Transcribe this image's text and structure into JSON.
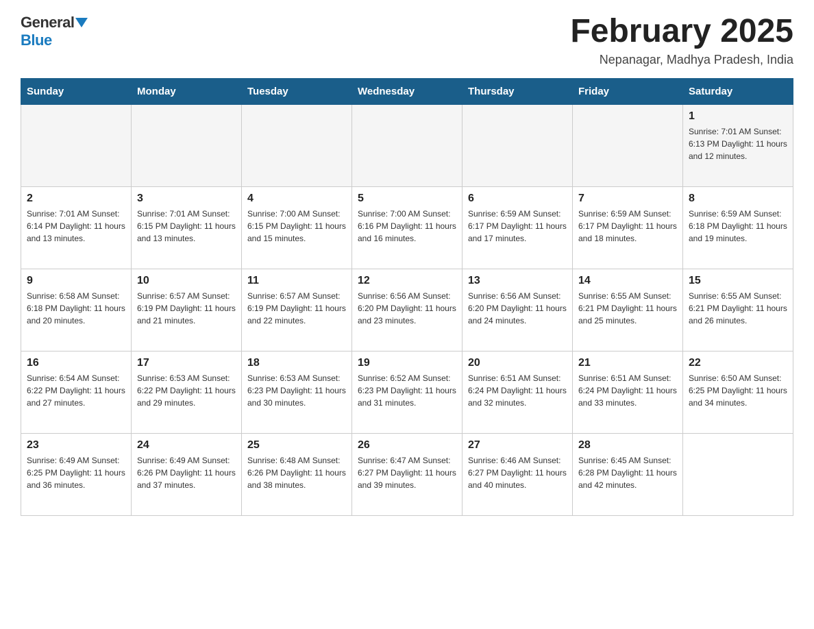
{
  "header": {
    "logo": {
      "general": "General",
      "blue": "Blue"
    },
    "title": "February 2025",
    "location": "Nepanagar, Madhya Pradesh, India"
  },
  "weekdays": [
    "Sunday",
    "Monday",
    "Tuesday",
    "Wednesday",
    "Thursday",
    "Friday",
    "Saturday"
  ],
  "weeks": [
    [
      {
        "day": "",
        "info": ""
      },
      {
        "day": "",
        "info": ""
      },
      {
        "day": "",
        "info": ""
      },
      {
        "day": "",
        "info": ""
      },
      {
        "day": "",
        "info": ""
      },
      {
        "day": "",
        "info": ""
      },
      {
        "day": "1",
        "info": "Sunrise: 7:01 AM\nSunset: 6:13 PM\nDaylight: 11 hours and 12 minutes."
      }
    ],
    [
      {
        "day": "2",
        "info": "Sunrise: 7:01 AM\nSunset: 6:14 PM\nDaylight: 11 hours and 13 minutes."
      },
      {
        "day": "3",
        "info": "Sunrise: 7:01 AM\nSunset: 6:15 PM\nDaylight: 11 hours and 13 minutes."
      },
      {
        "day": "4",
        "info": "Sunrise: 7:00 AM\nSunset: 6:15 PM\nDaylight: 11 hours and 15 minutes."
      },
      {
        "day": "5",
        "info": "Sunrise: 7:00 AM\nSunset: 6:16 PM\nDaylight: 11 hours and 16 minutes."
      },
      {
        "day": "6",
        "info": "Sunrise: 6:59 AM\nSunset: 6:17 PM\nDaylight: 11 hours and 17 minutes."
      },
      {
        "day": "7",
        "info": "Sunrise: 6:59 AM\nSunset: 6:17 PM\nDaylight: 11 hours and 18 minutes."
      },
      {
        "day": "8",
        "info": "Sunrise: 6:59 AM\nSunset: 6:18 PM\nDaylight: 11 hours and 19 minutes."
      }
    ],
    [
      {
        "day": "9",
        "info": "Sunrise: 6:58 AM\nSunset: 6:18 PM\nDaylight: 11 hours and 20 minutes."
      },
      {
        "day": "10",
        "info": "Sunrise: 6:57 AM\nSunset: 6:19 PM\nDaylight: 11 hours and 21 minutes."
      },
      {
        "day": "11",
        "info": "Sunrise: 6:57 AM\nSunset: 6:19 PM\nDaylight: 11 hours and 22 minutes."
      },
      {
        "day": "12",
        "info": "Sunrise: 6:56 AM\nSunset: 6:20 PM\nDaylight: 11 hours and 23 minutes."
      },
      {
        "day": "13",
        "info": "Sunrise: 6:56 AM\nSunset: 6:20 PM\nDaylight: 11 hours and 24 minutes."
      },
      {
        "day": "14",
        "info": "Sunrise: 6:55 AM\nSunset: 6:21 PM\nDaylight: 11 hours and 25 minutes."
      },
      {
        "day": "15",
        "info": "Sunrise: 6:55 AM\nSunset: 6:21 PM\nDaylight: 11 hours and 26 minutes."
      }
    ],
    [
      {
        "day": "16",
        "info": "Sunrise: 6:54 AM\nSunset: 6:22 PM\nDaylight: 11 hours and 27 minutes."
      },
      {
        "day": "17",
        "info": "Sunrise: 6:53 AM\nSunset: 6:22 PM\nDaylight: 11 hours and 29 minutes."
      },
      {
        "day": "18",
        "info": "Sunrise: 6:53 AM\nSunset: 6:23 PM\nDaylight: 11 hours and 30 minutes."
      },
      {
        "day": "19",
        "info": "Sunrise: 6:52 AM\nSunset: 6:23 PM\nDaylight: 11 hours and 31 minutes."
      },
      {
        "day": "20",
        "info": "Sunrise: 6:51 AM\nSunset: 6:24 PM\nDaylight: 11 hours and 32 minutes."
      },
      {
        "day": "21",
        "info": "Sunrise: 6:51 AM\nSunset: 6:24 PM\nDaylight: 11 hours and 33 minutes."
      },
      {
        "day": "22",
        "info": "Sunrise: 6:50 AM\nSunset: 6:25 PM\nDaylight: 11 hours and 34 minutes."
      }
    ],
    [
      {
        "day": "23",
        "info": "Sunrise: 6:49 AM\nSunset: 6:25 PM\nDaylight: 11 hours and 36 minutes."
      },
      {
        "day": "24",
        "info": "Sunrise: 6:49 AM\nSunset: 6:26 PM\nDaylight: 11 hours and 37 minutes."
      },
      {
        "day": "25",
        "info": "Sunrise: 6:48 AM\nSunset: 6:26 PM\nDaylight: 11 hours and 38 minutes."
      },
      {
        "day": "26",
        "info": "Sunrise: 6:47 AM\nSunset: 6:27 PM\nDaylight: 11 hours and 39 minutes."
      },
      {
        "day": "27",
        "info": "Sunrise: 6:46 AM\nSunset: 6:27 PM\nDaylight: 11 hours and 40 minutes."
      },
      {
        "day": "28",
        "info": "Sunrise: 6:45 AM\nSunset: 6:28 PM\nDaylight: 11 hours and 42 minutes."
      },
      {
        "day": "",
        "info": ""
      }
    ]
  ]
}
